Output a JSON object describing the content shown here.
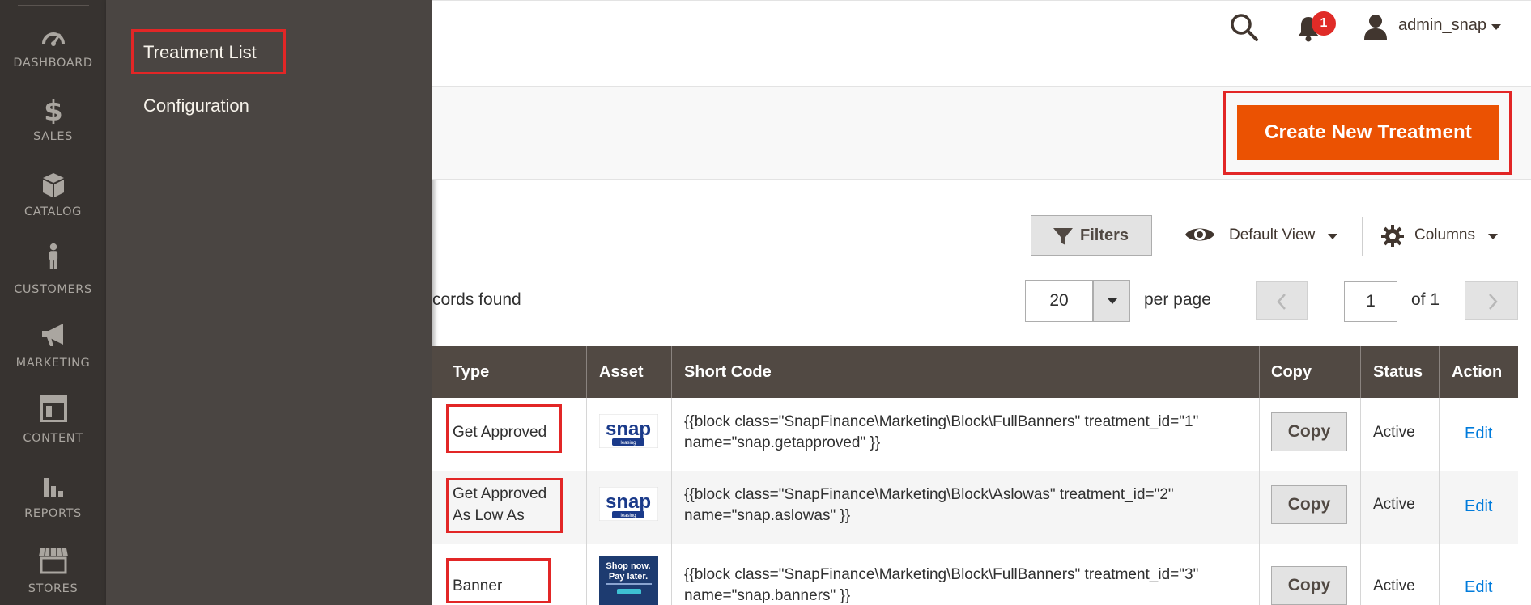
{
  "nav": {
    "items": [
      {
        "label": "DASHBOARD",
        "icon": "dashboard-icon"
      },
      {
        "label": "SALES",
        "icon": "dollar-icon"
      },
      {
        "label": "CATALOG",
        "icon": "box-icon"
      },
      {
        "label": "CUSTOMERS",
        "icon": "person-icon"
      },
      {
        "label": "MARKETING",
        "icon": "megaphone-icon"
      },
      {
        "label": "CONTENT",
        "icon": "layout-icon"
      },
      {
        "label": "REPORTS",
        "icon": "bar-chart-icon"
      },
      {
        "label": "STORES",
        "icon": "storefront-icon"
      }
    ]
  },
  "submenu": {
    "items": [
      {
        "label": "Treatment List"
      },
      {
        "label": "Configuration"
      }
    ]
  },
  "header": {
    "notification_count": "1",
    "user": "admin_snap"
  },
  "actions": {
    "create_label": "Create New Treatment",
    "create_color": "#eb5202"
  },
  "toolbar": {
    "filters_label": "Filters",
    "view_label": "Default View",
    "columns_label": "Columns",
    "records_text": "cords found",
    "per_page_value": "20",
    "per_page_label": "per page",
    "page_value": "1",
    "of_label": "of 1"
  },
  "table": {
    "columns": [
      "Type",
      "Asset",
      "Short Code",
      "Copy",
      "Status",
      "Action"
    ],
    "rows": [
      {
        "type": "Get Approved",
        "asset": "snap leasing logo",
        "asset_text": [
          "snap",
          "leasing"
        ],
        "short_code_1": "{{block class=\"SnapFinance\\Marketing\\Block\\FullBanners\" treatment_id=\"1\"",
        "short_code_2": "name=\"snap.getapproved\" }}",
        "copy": "Copy",
        "status": "Active",
        "action": "Edit"
      },
      {
        "type_1": "Get Approved",
        "type_2": "As Low As",
        "asset": "snap leasing logo",
        "asset_text": [
          "snap",
          "leasing"
        ],
        "short_code_1": "{{block class=\"SnapFinance\\Marketing\\Block\\Aslowas\" treatment_id=\"2\"",
        "short_code_2": "name=\"snap.aslowas\" }}",
        "copy": "Copy",
        "status": "Active",
        "action": "Edit"
      },
      {
        "type": "Banner",
        "asset": "shop now pay later banner",
        "asset_text": [
          "Shop now.",
          "Pay later."
        ],
        "short_code_1": "{{block class=\"SnapFinance\\Marketing\\Block\\FullBanners\" treatment_id=\"3\"",
        "short_code_2": "name=\"snap.banners\" }}",
        "copy": "Copy",
        "status": "Active",
        "action": "Edit"
      }
    ]
  },
  "colors": {
    "nav_bg": "#373330",
    "flyout_bg": "#4a4542",
    "table_header_bg": "#514943",
    "highlight": "#e22626",
    "link": "#007bdb"
  }
}
